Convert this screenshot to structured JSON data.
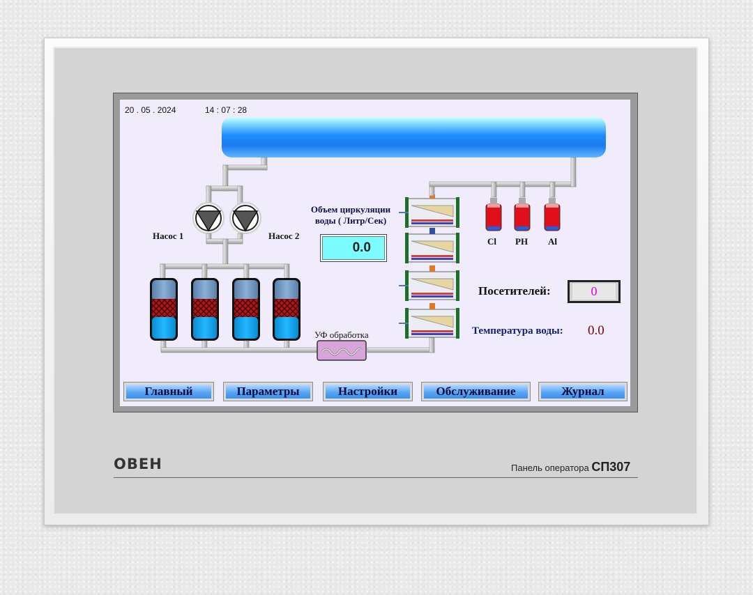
{
  "device": {
    "brand": "ОВЕН",
    "model_caption": "Панель оператора",
    "model_code": "СП307"
  },
  "status": {
    "date": "20 . 05 . 2024",
    "time": "14 : 07 : 28"
  },
  "pumps": {
    "pump1_label": "Насос 1",
    "pump2_label": "Насос 2"
  },
  "flow": {
    "label_line1": "Объем циркуляции",
    "label_line2": "воды ( Литр/Сек)",
    "value": "0.0"
  },
  "uv": {
    "label": "УФ обработка"
  },
  "dosing": {
    "tanks": [
      {
        "label": "Cl"
      },
      {
        "label": "PH"
      },
      {
        "label": "Al"
      }
    ]
  },
  "visitors": {
    "label": "Посетителей:",
    "value": "0"
  },
  "water_temp": {
    "label": "Температура воды:",
    "value": "0.0"
  },
  "nav": {
    "buttons": [
      {
        "label": "Главный"
      },
      {
        "label": "Параметры"
      },
      {
        "label": "Настройки"
      },
      {
        "label": "Обслуживание"
      },
      {
        "label": "Журнал"
      }
    ]
  },
  "colors": {
    "screen_bg": "#f1ecfb",
    "pipe": "#d6d6d6",
    "filter_water": "#14a8f0",
    "dosing_red": "#e0101a",
    "temp_value": "#800000",
    "temp_label": "#102070",
    "visitors_value": "#e000e0"
  }
}
